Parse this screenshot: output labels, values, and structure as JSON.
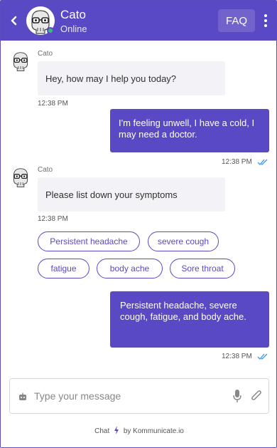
{
  "header": {
    "bot_name": "Cato",
    "status": "Online",
    "faq_label": "FAQ"
  },
  "messages": [
    {
      "type": "incoming",
      "sender": "Cato",
      "text": "Hey, how may I help you today?",
      "time": "12:38 PM"
    },
    {
      "type": "outgoing",
      "text": "I'm feeling unwell, I have a cold, I may need a doctor.",
      "time": "12:38 PM"
    },
    {
      "type": "incoming",
      "sender": "Cato",
      "text": "Please list down your symptoms",
      "time": "12:38 PM"
    },
    {
      "type": "outgoing",
      "text": "Persistent headache, severe cough, fatigue, and body ache.",
      "time": "12:38 PM"
    }
  ],
  "quick_replies": [
    "Persistent headache",
    "severe cough",
    "fatigue",
    "body ache",
    "Sore throat"
  ],
  "composer": {
    "placeholder": "Type your message"
  },
  "footer": {
    "prefix": "Chat",
    "suffix": "by Kommunicate.io"
  },
  "colors": {
    "brand": "#5a49c4",
    "online": "#3fb97b",
    "incoming_bubble": "#f3f3f7",
    "read_ticks": "#3d9be9"
  },
  "icons": [
    "back-icon",
    "avatar-icon",
    "kebab-menu-icon",
    "double-check-icon",
    "bot-icon",
    "mic-icon",
    "paperclip-icon",
    "bolt-icon"
  ]
}
